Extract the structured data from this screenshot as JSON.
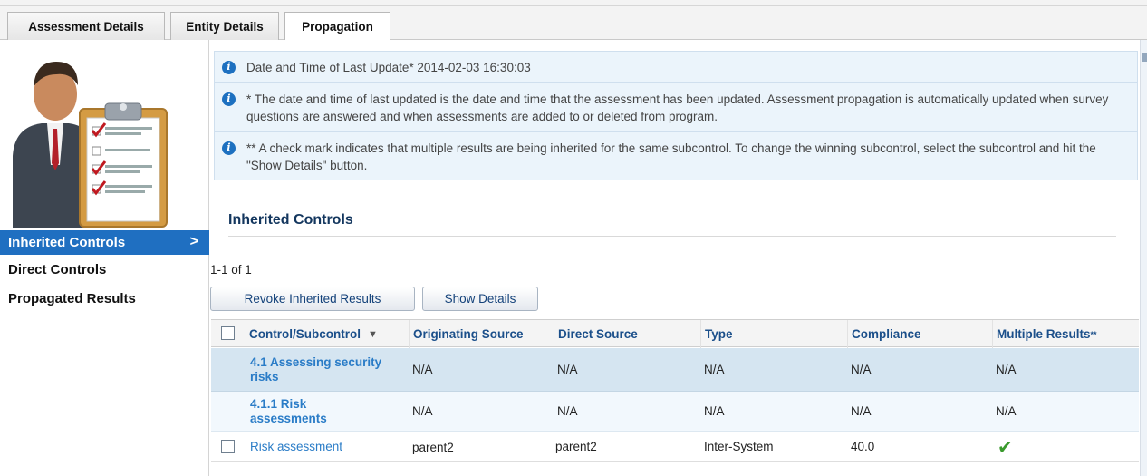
{
  "tabs": [
    {
      "label": "Assessment Details",
      "active": false
    },
    {
      "label": "Entity Details",
      "active": false
    },
    {
      "label": "Propagation",
      "active": true
    }
  ],
  "sidebar": {
    "items": [
      {
        "label": "Inherited Controls",
        "active": true
      },
      {
        "label": "Direct Controls",
        "active": false
      },
      {
        "label": "Propagated Results",
        "active": false
      }
    ],
    "active_chevron": ">"
  },
  "info": {
    "last_update": "Date and Time of Last Update* 2014-02-03 16:30:03",
    "note1": "* The date and time of last updated is the date and time that the assessment has been updated. Assessment propagation is automatically updated when survey questions are answered and when assessments are added to or deleted from program.",
    "note2": "** A check mark indicates that multiple results are being inherited for the same subcontrol. To change the winning subcontrol, select the subcontrol and hit the \"Show Details\" button."
  },
  "section": {
    "title": "Inherited Controls",
    "count": "1-1 of 1"
  },
  "buttons": {
    "revoke": "Revoke Inherited Results",
    "show_details": "Show Details"
  },
  "table": {
    "headers": {
      "control": "Control/Subcontrol",
      "originating_source": "Originating Source",
      "direct_source": "Direct Source",
      "type": "Type",
      "compliance": "Compliance",
      "multiple_results": "Multiple Results",
      "multiple_results_suffix": "**"
    },
    "rows": [
      {
        "control": "4.1 Assessing security risks",
        "originating_source": "N/A",
        "direct_source": "N/A",
        "type": "N/A",
        "compliance": "N/A",
        "multiple_results": "N/A"
      },
      {
        "control": "4.1.1 Risk assessments",
        "originating_source": "N/A",
        "direct_source": "N/A",
        "type": "N/A",
        "compliance": "N/A",
        "multiple_results": "N/A"
      },
      {
        "control": "Risk assessment",
        "originating_source": "parent2",
        "direct_source": "parent2",
        "type": "Inter-System",
        "compliance": "40.0",
        "multiple_results_icon": "checkmark-icon"
      }
    ]
  },
  "colors": {
    "accent": "#1f6fc1",
    "header_text": "#1b4f8a",
    "link": "#2a7cc7",
    "info_bg": "#ebf4fb",
    "selected_row": "#d5e5f1",
    "check": "#3a9a2d"
  }
}
